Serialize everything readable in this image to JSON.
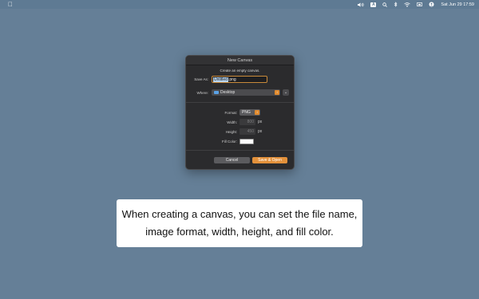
{
  "menubar": {
    "clock": "Sat Jun 29  17:59"
  },
  "dialog": {
    "title": "New Canvas",
    "subtitle": "Create an empty canvas.",
    "save_as_label": "Save As:",
    "save_as_selected": "Untitled",
    "save_as_ext": ".png",
    "where_label": "Where:",
    "where_value": "Desktop",
    "format_label": "Format:",
    "format_value": "PNG",
    "width_label": "Width:",
    "width_value": "800",
    "width_unit": "px",
    "height_label": "Height:",
    "height_value": "450",
    "height_unit": "px",
    "fill_label": "Fill Color:",
    "fill_color": "#ffffff",
    "cancel_label": "Cancel",
    "save_label": "Save & Open"
  },
  "caption": {
    "line1": "When creating a canvas, you can set the file name,",
    "line2": "image format, width, height, and fill color."
  }
}
